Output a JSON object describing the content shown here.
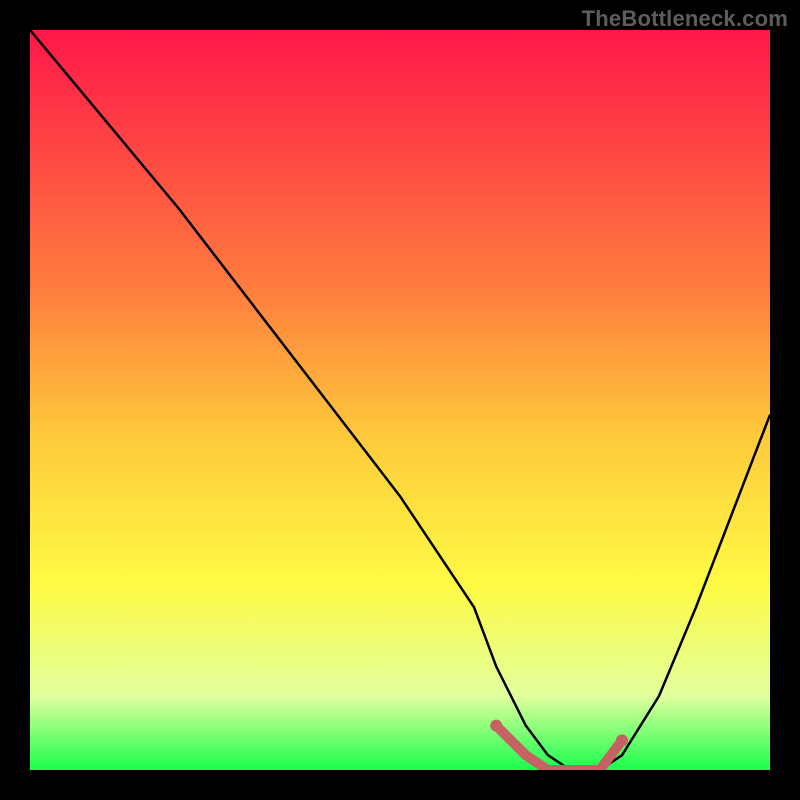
{
  "watermark": "TheBottleneck.com",
  "chart_data": {
    "type": "line",
    "title": "",
    "xlabel": "",
    "ylabel": "",
    "xlim": [
      0,
      100
    ],
    "ylim": [
      0,
      100
    ],
    "curve": {
      "name": "bottleneck-curve",
      "x": [
        0,
        5,
        10,
        20,
        30,
        40,
        50,
        60,
        63,
        67,
        70,
        73,
        77,
        80,
        85,
        90,
        95,
        100
      ],
      "y": [
        100,
        94,
        88,
        76,
        63,
        50,
        37,
        22,
        14,
        6,
        2,
        0,
        0,
        2,
        10,
        22,
        35,
        48
      ]
    },
    "highlight_segment": {
      "name": "optimal-range",
      "x": [
        63,
        67,
        70,
        73,
        77,
        80
      ],
      "y": [
        6,
        2,
        0,
        0,
        0,
        4
      ],
      "color": "#c56264"
    },
    "background_gradient": {
      "colors": [
        "#ff1749",
        "#ff7d3e",
        "#feca3b",
        "#fffb44",
        "#e1ff9e",
        "#19ff4d"
      ],
      "positions": [
        0,
        0.35,
        0.55,
        0.75,
        0.9,
        1.0
      ]
    }
  }
}
